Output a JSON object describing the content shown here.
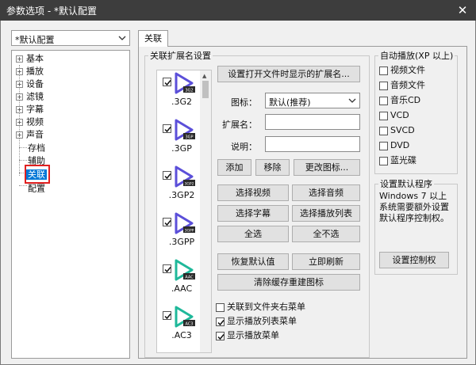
{
  "window": {
    "title": "参数选项 - *默认配置",
    "close_glyph": "✕"
  },
  "profile": {
    "value": "*默认配置"
  },
  "tree": {
    "items": [
      {
        "label": "基本",
        "expandable": true
      },
      {
        "label": "播放",
        "expandable": true
      },
      {
        "label": "设备",
        "expandable": true
      },
      {
        "label": "滤镜",
        "expandable": true
      },
      {
        "label": "字幕",
        "expandable": true
      },
      {
        "label": "视频",
        "expandable": true
      },
      {
        "label": "声音",
        "expandable": true
      },
      {
        "label": "存档",
        "expandable": false
      },
      {
        "label": "辅助",
        "expandable": false
      },
      {
        "label": "关联",
        "expandable": false,
        "selected": true
      },
      {
        "label": "配置",
        "expandable": false
      }
    ]
  },
  "tab": {
    "label": "关联"
  },
  "assoc": {
    "group_title": "关联扩展名设置",
    "files": [
      {
        "ext": ".3G2",
        "badge": "3G2",
        "checked": true,
        "color": "#5b4fd9"
      },
      {
        "ext": ".3GP",
        "badge": "3GP",
        "checked": true,
        "color": "#5b4fd9"
      },
      {
        "ext": ".3GP2",
        "badge": "3GP2",
        "checked": true,
        "color": "#5b4fd9"
      },
      {
        "ext": ".3GPP",
        "badge": "3GPP",
        "checked": true,
        "color": "#5b4fd9"
      },
      {
        "ext": ".AAC",
        "badge": "AAC",
        "checked": true,
        "color": "#1fb89a"
      },
      {
        "ext": ".AC3",
        "badge": "AC3",
        "checked": true,
        "color": "#1fb89a"
      }
    ],
    "set_ext_button": "设置打开文件时显示的扩展名...",
    "icon_label": "图标：",
    "icon_value": "默认(推荐)",
    "ext_name_label": "扩展名：",
    "ext_name_value": "",
    "desc_label": "说明：",
    "desc_value": "",
    "add_button": "添加",
    "remove_button": "移除",
    "change_icon_button": "更改图标...",
    "select_video_button": "选择视频",
    "select_audio_button": "选择音频",
    "select_subtitle_button": "选择字幕",
    "select_playlist_button": "选择播放列表",
    "select_all_button": "全选",
    "select_none_button": "全不选",
    "restore_default_button": "恢复默认值",
    "refresh_button": "立即刷新",
    "clear_cache_button": "清除缓存重建图标",
    "options": [
      {
        "label": "关联到文件夹右菜单",
        "checked": false
      },
      {
        "label": "显示播放列表菜单",
        "checked": true
      },
      {
        "label": "显示播放菜单",
        "checked": true
      }
    ]
  },
  "autoplay": {
    "title": "自动播放(XP 以上)",
    "items": [
      {
        "label": "视频文件",
        "checked": false
      },
      {
        "label": "音频文件",
        "checked": false
      },
      {
        "label": "音乐CD",
        "checked": false
      },
      {
        "label": "VCD",
        "checked": false
      },
      {
        "label": "SVCD",
        "checked": false
      },
      {
        "label": "DVD",
        "checked": false
      },
      {
        "label": "蓝光碟",
        "checked": false
      }
    ]
  },
  "default_program": {
    "title": "设置默认程序",
    "note": "Windows 7 以上系统需要额外设置默认程序控制权。",
    "button": "设置控制权"
  }
}
